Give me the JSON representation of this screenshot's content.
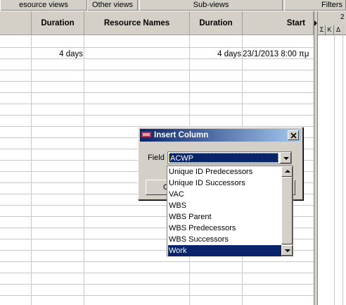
{
  "menu": [
    "esource views",
    "Other views",
    "Sub-views",
    "Filters"
  ],
  "columns": [
    "Duration",
    "Resource Names",
    "Duration",
    "Start"
  ],
  "row1": {
    "duration1": "4 days",
    "resource_names": "",
    "duration2": "4 days",
    "start": "23/1/2013 8:00 πμ"
  },
  "gantt": {
    "header_date": "2",
    "day_letters": [
      "Σ",
      "Κ",
      "Δ"
    ]
  },
  "dialog": {
    "title": "Insert Column",
    "field_label": "Field",
    "field_value": "ACWP",
    "button_partial": "O",
    "options": [
      "Unique ID Predecessors",
      "Unique ID Successors",
      "VAC",
      "WBS",
      "WBS Parent",
      "WBS Predecessors",
      "WBS Successors",
      "Work"
    ],
    "selected_option": "Work"
  },
  "colors": {
    "title_start": "#0a246a",
    "title_end": "#a6caf0",
    "selection": "#0a246a",
    "chrome": "#d4d0c8"
  }
}
